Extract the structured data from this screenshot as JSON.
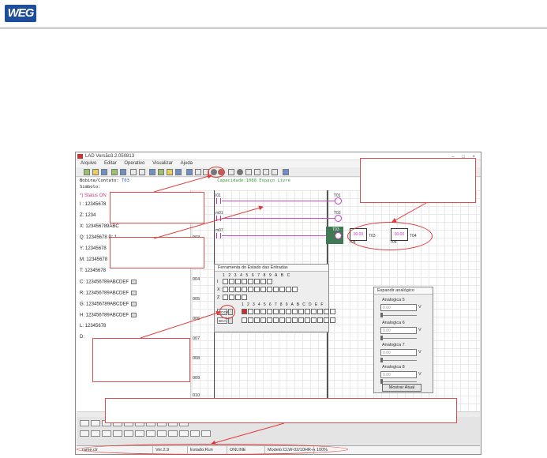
{
  "header": {
    "logo_text": "WEG"
  },
  "window": {
    "title": "LAD Versão3.2.050813",
    "controls": "– □ ×",
    "menu": [
      "Arquivo",
      "Editar",
      "Operativo",
      "Visualizar",
      "Ajuda"
    ],
    "info": {
      "bobina_label": "Bobina/Contato:",
      "bobina_value": "T03",
      "capacidade": "Capacidade:",
      "capacidade_value": "1088 Espaço Livre",
      "simbolo_label": "Simbolo:"
    }
  },
  "left_panel": {
    "status": "*) Status ON",
    "rows": [
      {
        "text": "I : 12345678",
        "button": false
      },
      {
        "text": "Z: 1234",
        "button": false
      },
      {
        "text": "X: 123456789ABC",
        "button": false
      },
      {
        "text": "Q: 12345678   P: 1",
        "button": false
      },
      {
        "text": "Y: 12345678",
        "button": false
      },
      {
        "text": "M: 12345678",
        "button": false
      },
      {
        "text": "T: 12345678",
        "button": false
      },
      {
        "text": "C: 123456789ABCDEF",
        "button": true
      },
      {
        "text": "R: 123456789ABCDEF",
        "button": true
      },
      {
        "text": "G: 123456789ABCDEF",
        "button": true
      },
      {
        "text": "H: 123456789ABCDEF",
        "button": true
      },
      {
        "text": "L: 12345678",
        "button": false
      },
      {
        "text": "D:",
        "button": false
      }
    ]
  },
  "ladder": {
    "row_labels": [
      "003",
      "004",
      "005",
      "006",
      "007",
      "008",
      "009",
      "010",
      "011"
    ],
    "rungs": [
      {
        "contact": "I01",
        "coil": "T01"
      },
      {
        "contact": "m01",
        "coil": "T02"
      },
      {
        "contact": "m07",
        "coil": "T03"
      }
    ],
    "timer": {
      "left_value": "00.00",
      "right_value": "00.00",
      "left_label": "T03",
      "right_label": "T04",
      "sub_left": "T04",
      "sub_right": "T04"
    }
  },
  "input_dialog": {
    "title": "Ferramenta do Estado das Entradas",
    "header_row1": "1 2 3 4 5 6 7 8 9 A B C",
    "row_labels": [
      "I",
      "X",
      "Z"
    ],
    "header_row2": "1 2 3 4 5 6 7 8 9 A B C D E F",
    "select_value": "BOOR",
    "select_value2": "BOA"
  },
  "analog_panel": {
    "title": "Expandir analógico",
    "channels": [
      {
        "name": "Analogica 5",
        "value": "0.00",
        "unit": "V"
      },
      {
        "name": "Analogica 6",
        "value": "0.00",
        "unit": "V"
      },
      {
        "name": "Analogica 7",
        "value": "0.00",
        "unit": "V"
      },
      {
        "name": "Analogica 8",
        "value": "0.00",
        "unit": "V"
      }
    ],
    "button": "Mostrar Atual"
  },
  "statusbar": {
    "file": "rame.clr",
    "version": "Ver.2.9",
    "state": "Estado:Run",
    "mode": "ONLINE",
    "model": "Modelo:CLW-02/10HR-A",
    "percent": "100%"
  }
}
